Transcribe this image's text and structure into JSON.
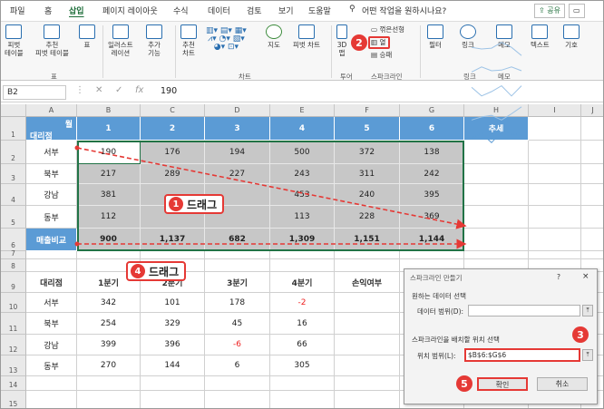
{
  "tabs": [
    "파일",
    "홈",
    "삽입",
    "페이지 레이아웃",
    "수식",
    "데이터",
    "검토",
    "보기",
    "도움말"
  ],
  "tell_me": "어떤 작업을 원하시나요?",
  "share": "공유",
  "comments": "메모",
  "ribbon": {
    "b1": "피벗\n테이블",
    "b2": "추천\n피벗 테이블",
    "b3": "표",
    "b4": "일러스트\n레이션",
    "b5": "추가\n기능",
    "b6": "추천\n차트",
    "b7": "지도",
    "b8": "피벗 차트",
    "b9": "3D\n맵",
    "spark_line": "꺾은선형",
    "spark_column": "열",
    "spark_winloss": "승패",
    "filter": "필터",
    "link": "링크",
    "memo": "메모",
    "text": "텍스트",
    "symbol": "기호",
    "grp_table": "표",
    "grp_chart": "차트",
    "grp_tour": "투어",
    "grp_spark": "스파크라인",
    "grp_link": "링크",
    "grp_memo": "메모"
  },
  "formula": {
    "name_box": "B2",
    "value": "190"
  },
  "columns": [
    "A",
    "B",
    "C",
    "D",
    "E",
    "F",
    "G",
    "H",
    "I",
    "J"
  ],
  "rows": [
    "1",
    "2",
    "3",
    "4",
    "5",
    "6",
    "7",
    "8",
    "9",
    "10",
    "11",
    "12",
    "13",
    "14",
    "15"
  ],
  "top_header": {
    "corner_top": "월",
    "corner_bottom": "대리점",
    "months": [
      "1",
      "2",
      "3",
      "4",
      "5",
      "6"
    ],
    "trend": "추세"
  },
  "top_rows": [
    {
      "name": "서부",
      "vals": [
        "190",
        "176",
        "194",
        "500",
        "372",
        "138"
      ]
    },
    {
      "name": "북부",
      "vals": [
        "217",
        "289",
        "227",
        "243",
        "311",
        "242"
      ]
    },
    {
      "name": "강남",
      "vals": [
        "381",
        "",
        "",
        "453",
        "240",
        "395"
      ]
    },
    {
      "name": "동부",
      "vals": [
        "112",
        "",
        "",
        "113",
        "228",
        "369"
      ]
    },
    {
      "name": "매출비교",
      "vals": [
        "900",
        "1,137",
        "682",
        "1,309",
        "1,151",
        "1,144"
      ]
    }
  ],
  "bottom_header": [
    "대리점",
    "1분기",
    "2분기",
    "3분기",
    "4분기",
    "손익여부"
  ],
  "bottom_rows": [
    {
      "name": "서부",
      "vals": [
        "342",
        "101",
        "178",
        "-2",
        ""
      ]
    },
    {
      "name": "북부",
      "vals": [
        "254",
        "329",
        "45",
        "16",
        ""
      ]
    },
    {
      "name": "강남",
      "vals": [
        "399",
        "396",
        "-6",
        "66",
        ""
      ]
    },
    {
      "name": "동부",
      "vals": [
        "270",
        "144",
        "6",
        "305",
        ""
      ]
    }
  ],
  "dialog": {
    "title": "스파크라인 만들기",
    "q": "?",
    "x": "×",
    "section1": "원하는 데이터 선택",
    "data_range_label": "데이터 범위(D):",
    "data_range_value": "",
    "section2": "스파크라인을 배치할 위치 선택",
    "loc_label": "위치 범위(L):",
    "loc_value": "$B$6:$G$6",
    "ok": "확인",
    "cancel": "취소"
  },
  "callouts": {
    "c1_num": "1",
    "c1_text": "드래그",
    "c4_num": "4",
    "c4_text": "드래그",
    "b2": "2",
    "b3": "3",
    "b5": "5"
  }
}
